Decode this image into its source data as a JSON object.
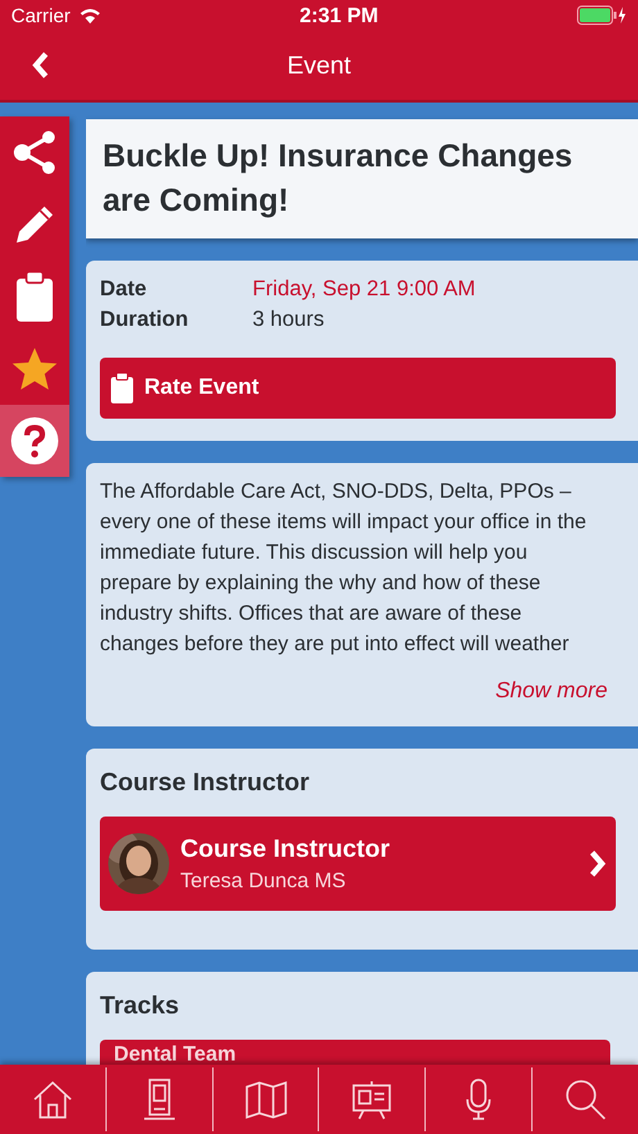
{
  "status_bar": {
    "carrier": "Carrier",
    "time": "2:31 PM"
  },
  "nav": {
    "title": "Event"
  },
  "side_actions": [
    {
      "kind": "share",
      "selected": false
    },
    {
      "kind": "edit",
      "selected": false
    },
    {
      "kind": "clipboard",
      "selected": false
    },
    {
      "kind": "star",
      "selected": false
    },
    {
      "kind": "help",
      "selected": true
    }
  ],
  "event": {
    "title": "Buckle Up! Insurance Changes are Coming!",
    "details": [
      {
        "label": "Date",
        "value": "Friday, Sep 21 9:00 AM",
        "kind": "highlight"
      },
      {
        "label": "Duration",
        "value": "3 hours",
        "kind": "plain"
      }
    ],
    "rate_button": "Rate Event",
    "description": "The Affordable Care Act, SNO-DDS, Delta, PPOs – every one of these items will impact your office in the immediate future. This discussion will help you prepare by explaining the why and how of these industry shifts. Offices that are aware of these changes before they are put into effect will weather",
    "show_more": "Show more"
  },
  "instructor_section": {
    "heading": "Course Instructor",
    "card": {
      "title": "Course Instructor",
      "name": "Teresa Dunca MS"
    }
  },
  "tracks_section": {
    "heading": "Tracks",
    "items": [
      "Dental Team"
    ]
  },
  "tab_bar": [
    {
      "kind": "home"
    },
    {
      "kind": "kiosk"
    },
    {
      "kind": "map"
    },
    {
      "kind": "presentation"
    },
    {
      "kind": "mic"
    },
    {
      "kind": "search"
    }
  ]
}
